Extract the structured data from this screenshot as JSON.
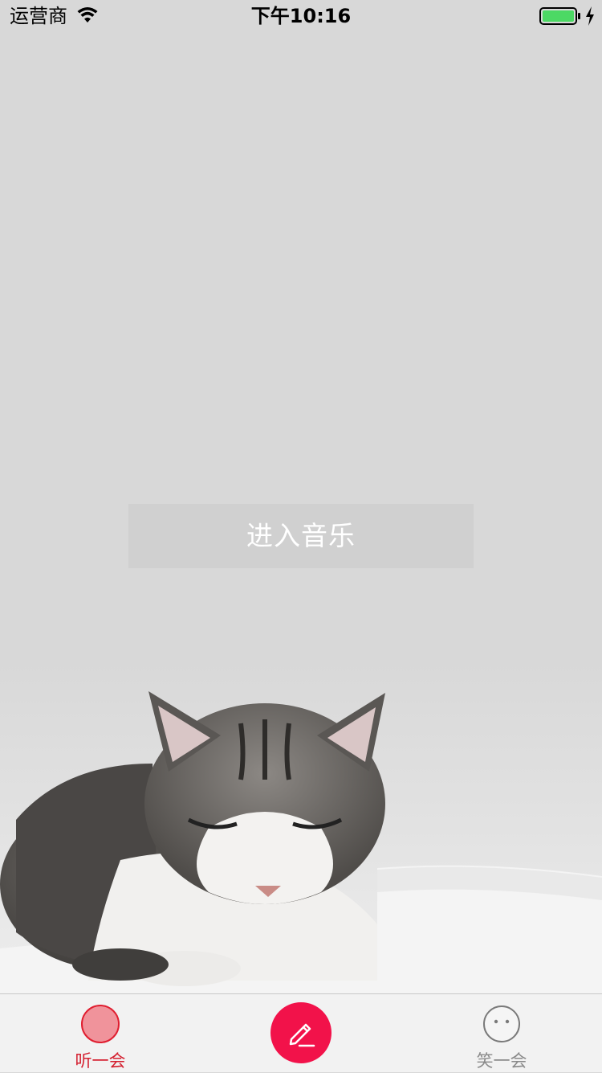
{
  "status_bar": {
    "carrier": "运营商",
    "time": "下午10:16",
    "battery_color": "#4cd964"
  },
  "main": {
    "enter_music_label": "进入音乐"
  },
  "tab_bar": {
    "tabs": [
      {
        "label": "听一会",
        "icon": "record-circle-icon",
        "selected": true
      },
      {
        "label": "笑一会",
        "icon": "smiley-face-icon",
        "selected": false
      }
    ],
    "compose_icon": "pencil-icon",
    "accent_color": "#f2124a"
  }
}
